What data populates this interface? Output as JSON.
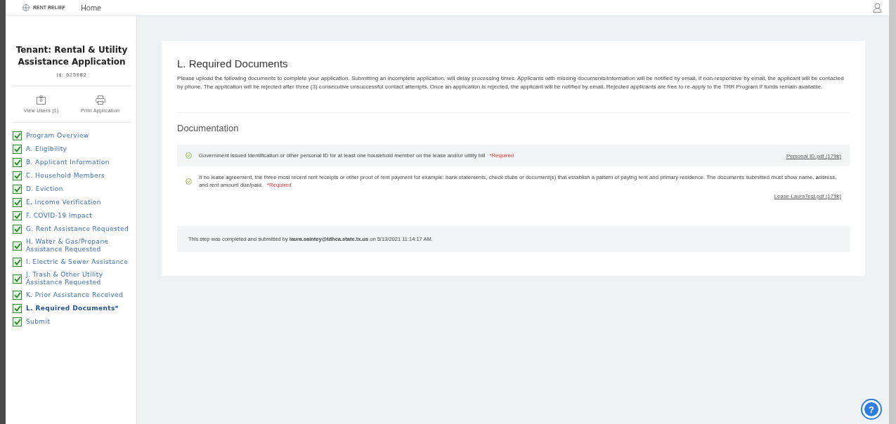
{
  "top_bar": {
    "logo_text": "RENT RELIEF",
    "nav": [
      {
        "label": "Home"
      }
    ]
  },
  "sidebar": {
    "title": "Tenant: Rental & Utility Assistance Application",
    "id": "Id: 625982",
    "actions": [
      {
        "kind": "users",
        "label": "View Users (1)"
      },
      {
        "kind": "print",
        "label": "Print Application"
      }
    ],
    "items": [
      {
        "label": "Program Overview",
        "checked": true,
        "selected": false
      },
      {
        "label": "A. Eligibility",
        "checked": true,
        "selected": false
      },
      {
        "label": "B. Applicant Information",
        "checked": true,
        "selected": false
      },
      {
        "label": "C. Household Members",
        "checked": true,
        "selected": false
      },
      {
        "label": "D. Eviction",
        "checked": true,
        "selected": false
      },
      {
        "label": "E. Income Verification",
        "checked": true,
        "selected": false
      },
      {
        "label": "F. COVID-19 Impact",
        "checked": true,
        "selected": false
      },
      {
        "label": "G. Rent Assistance Requested",
        "checked": true,
        "selected": false
      },
      {
        "label": "H. Water & Gas/Propane Assistance Requested",
        "checked": true,
        "selected": false
      },
      {
        "label": "I. Electric & Sewer Assistance",
        "checked": true,
        "selected": false
      },
      {
        "label": "J. Trash & Other Utility Assistance Requested",
        "checked": true,
        "selected": false
      },
      {
        "label": "K. Prior Assistance Received",
        "checked": true,
        "selected": false
      },
      {
        "label": "L. Required Documents*",
        "checked": true,
        "selected": true
      },
      {
        "label": "Submit",
        "checked": true,
        "selected": false
      }
    ]
  },
  "section": {
    "title": "L. Required Documents",
    "description": "Please upload the following documents to complete your application. Submitting an incomplete application, will delay processing times. Applicants with missing documents/information will be notified by email, If non-responsive by email, the applicant will be contacted by phone. The application will be rejected after three (3) consecutive unsuccessful contact attempts. Once an application is rejected, the applicant will be notified by email. Rejected applicants are free to re-apply to the TRR Program if funds remain available.",
    "subtitle": "Documentation",
    "documents": [
      {
        "text": "Government issued identification or other personal ID for at least one household member on the lease and/or utility bill",
        "required": "*Required",
        "file": "Personal ID.pdf (179k)",
        "done": true
      },
      {
        "text": "If no lease agreement, the three most recent rent receipts or other proof of rent payment for example: bank statements, check stubs or document(s) that establish a pattern of paying rent and primary residence. The documents submitted must show name, address, and rent amount due/paid.",
        "required": "*Required",
        "file": "Lease-LauraTest.pdf (179k)",
        "done": true
      }
    ],
    "completion": "This step was completed and submitted by **laura.saintey@tdhca.state.tx.us** on 5/13/2021 11:14:17 AM."
  },
  "help": {
    "label": "?"
  }
}
